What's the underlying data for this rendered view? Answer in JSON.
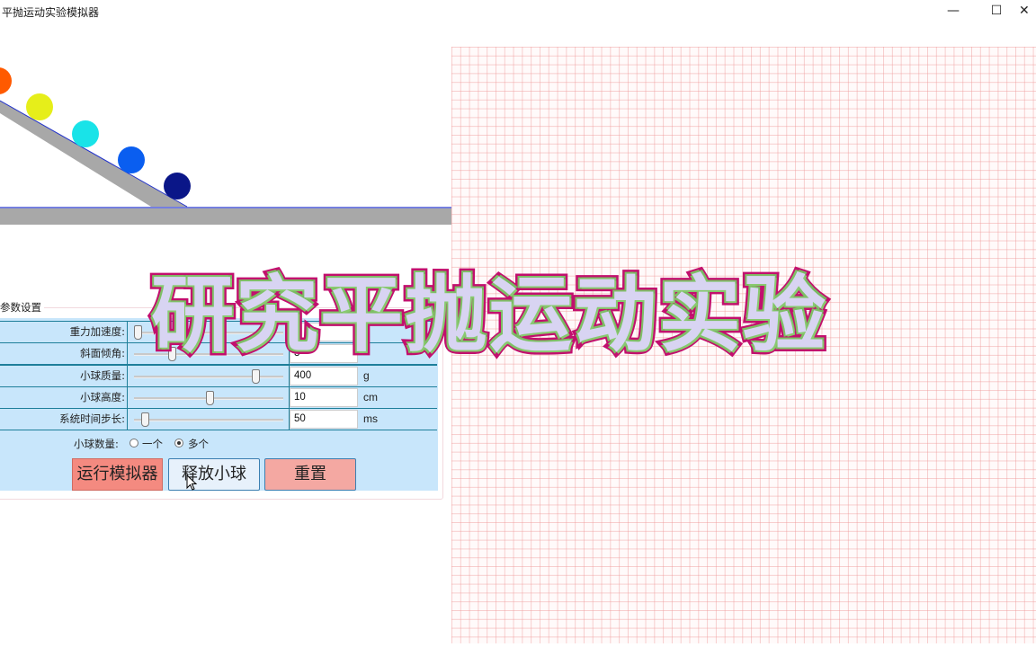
{
  "window": {
    "title": "平抛运动实验模拟器",
    "min_glyph": "—",
    "max_glyph": "☐",
    "close_glyph": "✕"
  },
  "simulation": {
    "ball_colors": [
      "#ff5a00",
      "#e6ee1a",
      "#19e3e8",
      "#0a5ef0",
      "#0a1688"
    ],
    "ramp_color": "#a8a8a8",
    "ground_color": "#a8a8a8",
    "line_color": "#2233cc"
  },
  "params": {
    "group_title": "参数设置",
    "rows": [
      {
        "label": "重力加速度:",
        "value": "",
        "unit": "",
        "slider_level": 0.0
      },
      {
        "label": "斜面倾角:",
        "value": "3",
        "unit": "",
        "slider_level": 0.24
      },
      {
        "label": "小球质量:",
        "value": "400",
        "unit": "g",
        "slider_level": 0.82
      },
      {
        "label": "小球高度:",
        "value": "10",
        "unit": "cm",
        "slider_level": 0.5
      },
      {
        "label": "系统时间步长:",
        "value": "50",
        "unit": "ms",
        "slider_level": 0.05
      }
    ],
    "ball_count_label": "小球数量:",
    "ball_count_options": [
      "一个",
      "多个"
    ],
    "ball_count_selected": "多个"
  },
  "buttons": {
    "run": "运行模拟器",
    "release": "释放小球",
    "reset": "重置"
  },
  "overlay": {
    "text": "研究平抛运动实验"
  }
}
